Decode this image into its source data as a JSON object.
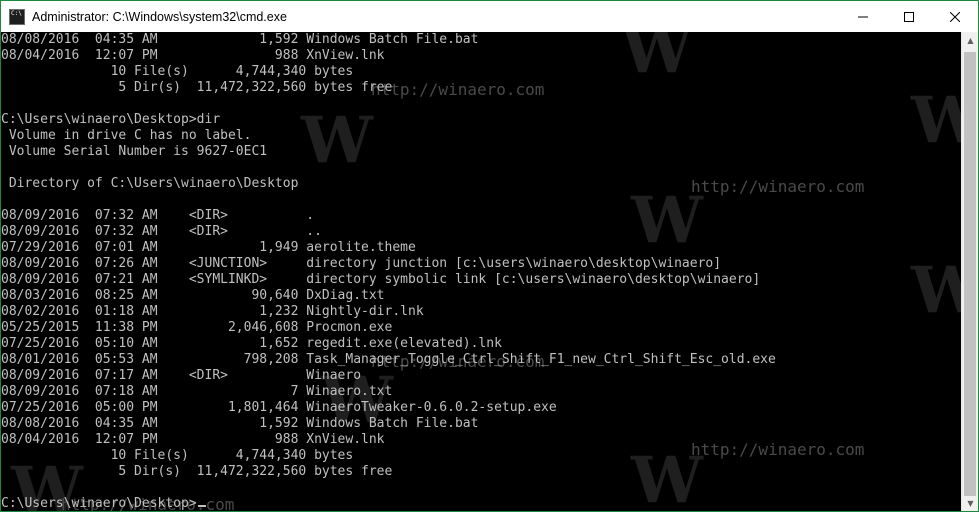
{
  "window": {
    "title": "Administrator: C:\\Windows\\system32\\cmd.exe",
    "icon_text": "C:\\",
    "icons": {
      "app": "cmd-icon",
      "minimize": "minimize-icon",
      "maximize": "maximize-icon",
      "close": "close-icon"
    },
    "colors": {
      "title_bg": "#ffffff",
      "border": "#1b8a3c",
      "console_bg": "#000000",
      "console_fg": "#c0c0c0",
      "scrollbar_bg": "#f0f0f0",
      "scrollbar_thumb": "#c1c1c1"
    }
  },
  "watermark": {
    "text": "http://winaero.com",
    "logo_letter": "W"
  },
  "console": {
    "lines": [
      "08/08/2016  04:35 AM             1,592 Windows Batch File.bat",
      "08/04/2016  12:07 PM               988 XnView.lnk",
      "              10 File(s)      4,744,340 bytes",
      "               5 Dir(s)  11,472,322,560 bytes free",
      "",
      "C:\\Users\\winaero\\Desktop>dir",
      " Volume in drive C has no label.",
      " Volume Serial Number is 9627-0EC1",
      "",
      " Directory of C:\\Users\\winaero\\Desktop",
      "",
      "08/09/2016  07:32 AM    <DIR>          .",
      "08/09/2016  07:32 AM    <DIR>          ..",
      "07/29/2016  07:01 AM             1,949 aerolite.theme",
      "08/09/2016  07:26 AM    <JUNCTION>     directory junction [c:\\users\\winaero\\desktop\\winaero]",
      "08/09/2016  07:21 AM    <SYMLINKD>     directory symbolic link [c:\\users\\winaero\\desktop\\winaero]",
      "08/03/2016  08:25 AM            90,640 DxDiag.txt",
      "08/02/2016  01:18 AM             1,232 Nightly-dir.lnk",
      "05/25/2015  11:38 PM         2,046,608 Procmon.exe",
      "07/25/2016  05:10 AM             1,652 regedit.exe(elevated).lnk",
      "08/01/2016  05:53 AM           798,208 Task_Manager_Toggle_Ctrl_Shift_F1_new_Ctrl_Shift_Esc_old.exe",
      "08/09/2016  07:17 AM    <DIR>          Winaero",
      "08/09/2016  07:18 AM                 7 Winaero.txt",
      "07/25/2016  05:00 PM         1,801,464 WinaeroTweaker-0.6.0.2-setup.exe",
      "08/08/2016  04:35 AM             1,592 Windows Batch File.bat",
      "08/04/2016  12:07 PM               988 XnView.lnk",
      "              10 File(s)      4,744,340 bytes",
      "               5 Dir(s)  11,472,322,560 bytes free",
      "",
      "C:\\Users\\winaero\\Desktop>"
    ]
  }
}
